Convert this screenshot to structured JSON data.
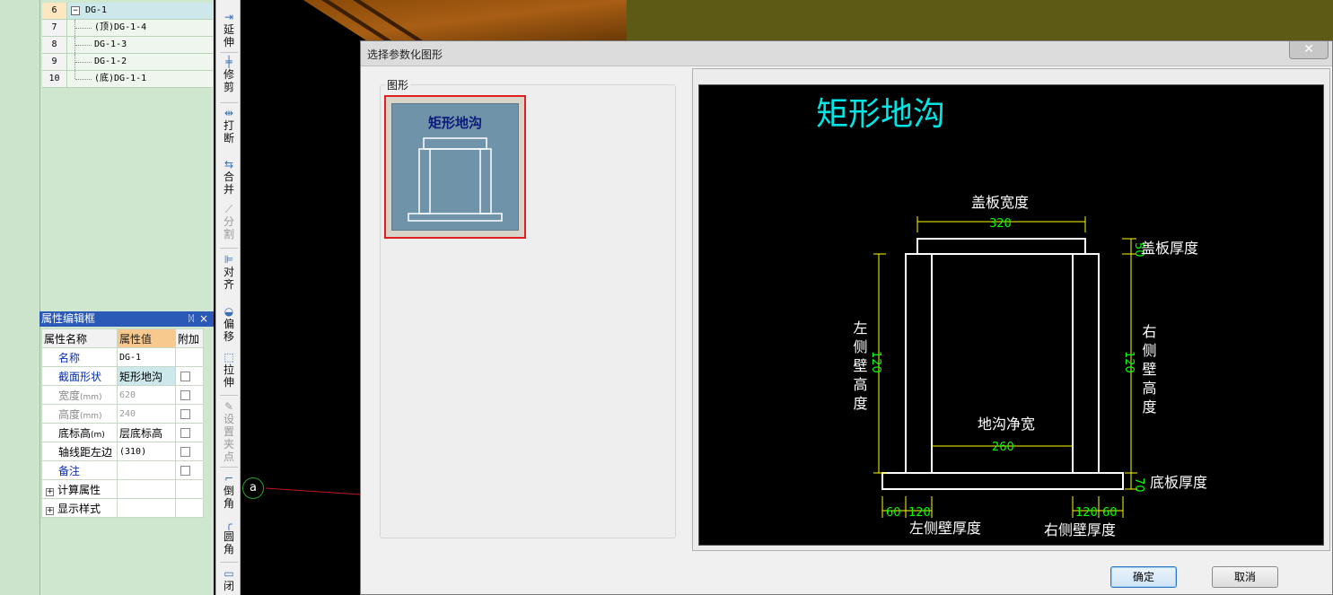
{
  "tree": {
    "rows": [
      {
        "num": "6",
        "label": "DG-1",
        "selected": true,
        "expander": "−"
      },
      {
        "num": "7",
        "label": "(顶)DG-1-4"
      },
      {
        "num": "8",
        "label": "DG-1-3"
      },
      {
        "num": "9",
        "label": "DG-1-2"
      },
      {
        "num": "10",
        "label": "(底)DG-1-1"
      }
    ]
  },
  "props": {
    "title": "属性编辑框",
    "pin": "ᛞ",
    "close": "×",
    "header": {
      "name": "属性名称",
      "value": "属性值",
      "extra": "附加"
    },
    "rows": [
      {
        "name": "名称",
        "value": "DG-1"
      },
      {
        "name": "截面形状",
        "value": "矩形地沟"
      },
      {
        "name": "宽度",
        "unit": "(mm)",
        "value": "620"
      },
      {
        "name": "高度",
        "unit": "(mm)",
        "value": "240"
      },
      {
        "name": "底标高",
        "unit": "(m)",
        "value": "层底标高"
      },
      {
        "name": "轴线距左边",
        "value": "(310)"
      },
      {
        "name": "备注",
        "value": ""
      },
      {
        "name": "计算属性",
        "expander": "+"
      },
      {
        "name": "显示样式",
        "expander": "+"
      }
    ]
  },
  "toolbar": {
    "items": [
      {
        "label": "延伸",
        "icon": "extend-icon",
        "glyph": "⇥"
      },
      {
        "label": "修剪",
        "icon": "trim-icon",
        "glyph": "╪"
      },
      {
        "label": "打断",
        "icon": "break-icon",
        "glyph": "⇹"
      },
      {
        "label": "合并",
        "icon": "merge-icon",
        "glyph": "⇆"
      },
      {
        "label": "分割",
        "icon": "split-icon",
        "glyph": "⟋"
      },
      {
        "label": "对齐",
        "icon": "align-icon",
        "glyph": "⊫"
      },
      {
        "label": "偏移",
        "icon": "offset-icon",
        "glyph": "◒"
      },
      {
        "label": "拉伸",
        "icon": "stretch-icon",
        "glyph": "⬚"
      },
      {
        "label": "设置夹点",
        "icon": "grip-icon",
        "glyph": "✎"
      },
      {
        "label": "倒角",
        "icon": "chamfer-icon",
        "glyph": "⌐"
      },
      {
        "label": "圆角",
        "icon": "fillet-icon",
        "glyph": "╭"
      },
      {
        "label": "闭",
        "icon": "close-shape-icon",
        "glyph": "▭"
      }
    ]
  },
  "canvas": {
    "axis_label": "a"
  },
  "dialog": {
    "title": "选择参数化图形",
    "close_glyph": "✕",
    "group_label": "图形",
    "thumbnail_title": "矩形地沟",
    "ok_label": "确定",
    "cancel_label": "取消"
  },
  "preview": {
    "title": "矩形地沟",
    "labels": {
      "cover_width": "盖板宽度",
      "cover_thickness": "盖板厚度",
      "left_wall_height": "左侧壁高度",
      "right_wall_height": "右侧壁高度",
      "clear_width": "地沟净宽",
      "bottom_thickness": "底板厚度",
      "left_wall_thickness": "左侧壁厚度",
      "right_wall_thickness": "右侧壁厚度"
    },
    "dims": {
      "cover_width": "320",
      "cover_thickness": "50",
      "left_wall_height": "120",
      "right_wall_height": "120",
      "clear_width": "260",
      "bottom_thickness": "70",
      "left_offset": "60",
      "left_wall": "120",
      "right_wall": "120",
      "right_offset": "60"
    },
    "colors": {
      "title": "#00e5e5",
      "dims": "#ffff00",
      "dim_text": "#00ff00",
      "lines": "#ffffff"
    }
  }
}
